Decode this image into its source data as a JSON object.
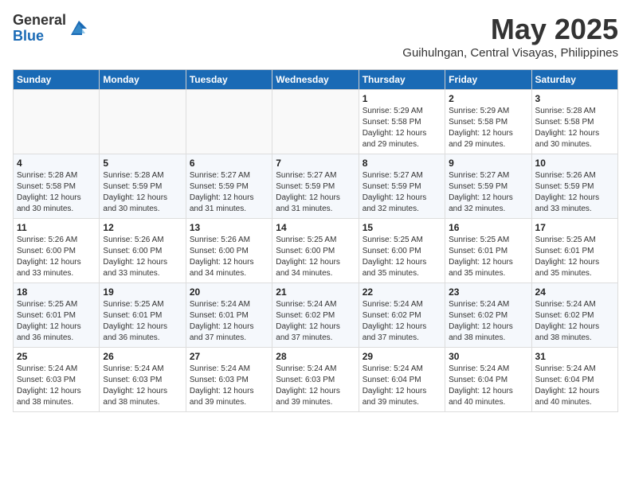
{
  "header": {
    "logo_line1": "General",
    "logo_line2": "Blue",
    "title": "May 2025",
    "subtitle": "Guihulngan, Central Visayas, Philippines"
  },
  "days_of_week": [
    "Sunday",
    "Monday",
    "Tuesday",
    "Wednesday",
    "Thursday",
    "Friday",
    "Saturday"
  ],
  "weeks": [
    [
      {
        "day": "",
        "info": ""
      },
      {
        "day": "",
        "info": ""
      },
      {
        "day": "",
        "info": ""
      },
      {
        "day": "",
        "info": ""
      },
      {
        "day": "1",
        "info": "Sunrise: 5:29 AM\nSunset: 5:58 PM\nDaylight: 12 hours\nand 29 minutes."
      },
      {
        "day": "2",
        "info": "Sunrise: 5:29 AM\nSunset: 5:58 PM\nDaylight: 12 hours\nand 29 minutes."
      },
      {
        "day": "3",
        "info": "Sunrise: 5:28 AM\nSunset: 5:58 PM\nDaylight: 12 hours\nand 30 minutes."
      }
    ],
    [
      {
        "day": "4",
        "info": "Sunrise: 5:28 AM\nSunset: 5:58 PM\nDaylight: 12 hours\nand 30 minutes."
      },
      {
        "day": "5",
        "info": "Sunrise: 5:28 AM\nSunset: 5:59 PM\nDaylight: 12 hours\nand 30 minutes."
      },
      {
        "day": "6",
        "info": "Sunrise: 5:27 AM\nSunset: 5:59 PM\nDaylight: 12 hours\nand 31 minutes."
      },
      {
        "day": "7",
        "info": "Sunrise: 5:27 AM\nSunset: 5:59 PM\nDaylight: 12 hours\nand 31 minutes."
      },
      {
        "day": "8",
        "info": "Sunrise: 5:27 AM\nSunset: 5:59 PM\nDaylight: 12 hours\nand 32 minutes."
      },
      {
        "day": "9",
        "info": "Sunrise: 5:27 AM\nSunset: 5:59 PM\nDaylight: 12 hours\nand 32 minutes."
      },
      {
        "day": "10",
        "info": "Sunrise: 5:26 AM\nSunset: 5:59 PM\nDaylight: 12 hours\nand 33 minutes."
      }
    ],
    [
      {
        "day": "11",
        "info": "Sunrise: 5:26 AM\nSunset: 6:00 PM\nDaylight: 12 hours\nand 33 minutes."
      },
      {
        "day": "12",
        "info": "Sunrise: 5:26 AM\nSunset: 6:00 PM\nDaylight: 12 hours\nand 33 minutes."
      },
      {
        "day": "13",
        "info": "Sunrise: 5:26 AM\nSunset: 6:00 PM\nDaylight: 12 hours\nand 34 minutes."
      },
      {
        "day": "14",
        "info": "Sunrise: 5:25 AM\nSunset: 6:00 PM\nDaylight: 12 hours\nand 34 minutes."
      },
      {
        "day": "15",
        "info": "Sunrise: 5:25 AM\nSunset: 6:00 PM\nDaylight: 12 hours\nand 35 minutes."
      },
      {
        "day": "16",
        "info": "Sunrise: 5:25 AM\nSunset: 6:01 PM\nDaylight: 12 hours\nand 35 minutes."
      },
      {
        "day": "17",
        "info": "Sunrise: 5:25 AM\nSunset: 6:01 PM\nDaylight: 12 hours\nand 35 minutes."
      }
    ],
    [
      {
        "day": "18",
        "info": "Sunrise: 5:25 AM\nSunset: 6:01 PM\nDaylight: 12 hours\nand 36 minutes."
      },
      {
        "day": "19",
        "info": "Sunrise: 5:25 AM\nSunset: 6:01 PM\nDaylight: 12 hours\nand 36 minutes."
      },
      {
        "day": "20",
        "info": "Sunrise: 5:24 AM\nSunset: 6:01 PM\nDaylight: 12 hours\nand 37 minutes."
      },
      {
        "day": "21",
        "info": "Sunrise: 5:24 AM\nSunset: 6:02 PM\nDaylight: 12 hours\nand 37 minutes."
      },
      {
        "day": "22",
        "info": "Sunrise: 5:24 AM\nSunset: 6:02 PM\nDaylight: 12 hours\nand 37 minutes."
      },
      {
        "day": "23",
        "info": "Sunrise: 5:24 AM\nSunset: 6:02 PM\nDaylight: 12 hours\nand 38 minutes."
      },
      {
        "day": "24",
        "info": "Sunrise: 5:24 AM\nSunset: 6:02 PM\nDaylight: 12 hours\nand 38 minutes."
      }
    ],
    [
      {
        "day": "25",
        "info": "Sunrise: 5:24 AM\nSunset: 6:03 PM\nDaylight: 12 hours\nand 38 minutes."
      },
      {
        "day": "26",
        "info": "Sunrise: 5:24 AM\nSunset: 6:03 PM\nDaylight: 12 hours\nand 38 minutes."
      },
      {
        "day": "27",
        "info": "Sunrise: 5:24 AM\nSunset: 6:03 PM\nDaylight: 12 hours\nand 39 minutes."
      },
      {
        "day": "28",
        "info": "Sunrise: 5:24 AM\nSunset: 6:03 PM\nDaylight: 12 hours\nand 39 minutes."
      },
      {
        "day": "29",
        "info": "Sunrise: 5:24 AM\nSunset: 6:04 PM\nDaylight: 12 hours\nand 39 minutes."
      },
      {
        "day": "30",
        "info": "Sunrise: 5:24 AM\nSunset: 6:04 PM\nDaylight: 12 hours\nand 40 minutes."
      },
      {
        "day": "31",
        "info": "Sunrise: 5:24 AM\nSunset: 6:04 PM\nDaylight: 12 hours\nand 40 minutes."
      }
    ]
  ]
}
